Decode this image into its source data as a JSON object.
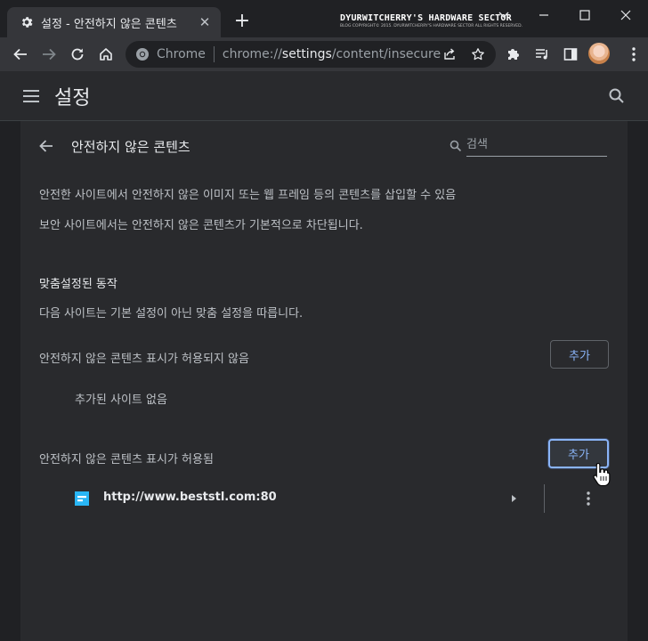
{
  "browser": {
    "tab_title": "설정 - 안전하지 않은 콘텐츠",
    "tab_icon": "gear-icon",
    "new_tab_icon": "plus-icon",
    "watermark_title": "DYURWITCHERRY'S HARDWARE SECTOR",
    "watermark_subtitle": "BLOG COPYRIGHT© 2015. DYURWITCHERRY'S HARDWARE SECTOR ALL RIGHTS RESERVED.",
    "omnibox_scheme": "Chrome",
    "omnibox_url_prefix": "chrome://",
    "omnibox_url_host": "settings",
    "omnibox_url_path": "/content/insecureC..."
  },
  "settings": {
    "header_title": "설정",
    "subpage_title": "안전하지 않은 콘텐츠",
    "search_placeholder": "검색",
    "description_1": "안전한 사이트에서 안전하지 않은 이미지 또는 웹 프레임 등의 콘텐츠를 삽입할 수 있음",
    "description_2": "보안 사이트에서는 안전하지 않은 콘텐츠가 기본적으로 차단됩니다.",
    "custom_section_title": "맞춤설정된 동작",
    "custom_section_desc": "다음 사이트는 기본 설정이 아닌 맞춤 설정을 따릅니다.",
    "blocked_label": "안전하지 않은 콘텐츠 표시가 허용되지 않음",
    "blocked_add_label": "추가",
    "blocked_empty": "추가된 사이트 없음",
    "allowed_label": "안전하지 않은 콘텐츠 표시가 허용됨",
    "allowed_add_label": "추가",
    "allowed_sites": [
      {
        "url": "http://www.beststl.com:80"
      }
    ]
  },
  "colors": {
    "background": "#202124",
    "card": "#292a2d",
    "accent": "#8ab4f8",
    "favicon": "#29b6f6"
  }
}
